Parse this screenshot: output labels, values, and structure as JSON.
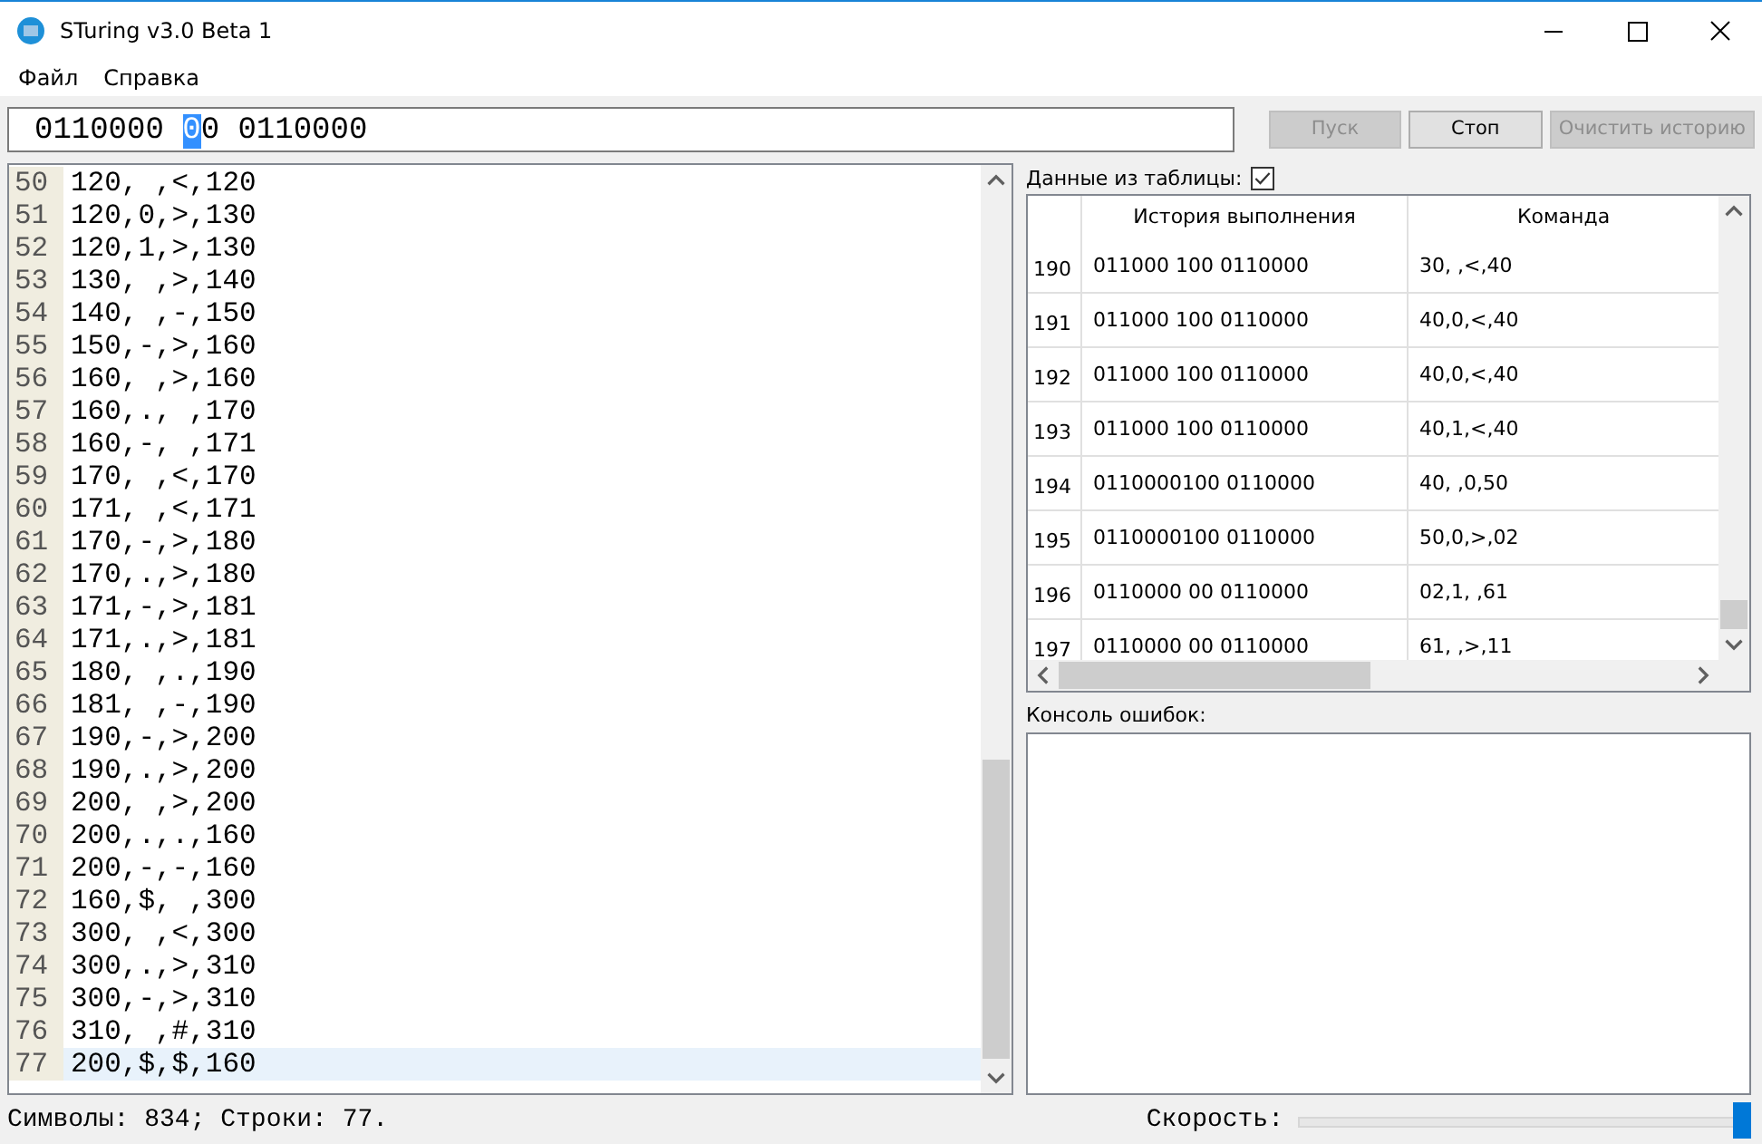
{
  "window": {
    "title": "STuring v3.0 Beta 1"
  },
  "menu": [
    "Файл",
    "Справка"
  ],
  "tape": {
    "before": "0110000 ",
    "head": "0",
    "after": "0 0110000"
  },
  "buttons": [
    {
      "label": "Пуск",
      "disabled": true
    },
    {
      "label": "Стоп",
      "disabled": false
    },
    {
      "label": "Очистить историю",
      "disabled": true
    }
  ],
  "editor": {
    "lines": [
      {
        "number": "50",
        "text": "120, ,<,120",
        "current": false
      },
      {
        "number": "51",
        "text": "120,0,>,130",
        "current": false
      },
      {
        "number": "52",
        "text": "120,1,>,130",
        "current": false
      },
      {
        "number": "53",
        "text": "130, ,>,140",
        "current": false
      },
      {
        "number": "54",
        "text": "140, ,-,150",
        "current": false
      },
      {
        "number": "55",
        "text": "150,-,>,160",
        "current": false
      },
      {
        "number": "56",
        "text": "160, ,>,160",
        "current": false
      },
      {
        "number": "57",
        "text": "160,., ,170",
        "current": false
      },
      {
        "number": "58",
        "text": "160,-, ,171",
        "current": false
      },
      {
        "number": "59",
        "text": "170, ,<,170",
        "current": false
      },
      {
        "number": "60",
        "text": "171, ,<,171",
        "current": false
      },
      {
        "number": "61",
        "text": "170,-,>,180",
        "current": false
      },
      {
        "number": "62",
        "text": "170,.,>,180",
        "current": false
      },
      {
        "number": "63",
        "text": "171,-,>,181",
        "current": false
      },
      {
        "number": "64",
        "text": "171,.,>,181",
        "current": false
      },
      {
        "number": "65",
        "text": "180, ,.,190",
        "current": false
      },
      {
        "number": "66",
        "text": "181, ,-,190",
        "current": false
      },
      {
        "number": "67",
        "text": "190,-,>,200",
        "current": false
      },
      {
        "number": "68",
        "text": "190,.,>,200",
        "current": false
      },
      {
        "number": "69",
        "text": "200, ,>,200",
        "current": false
      },
      {
        "number": "70",
        "text": "200,.,.,160",
        "current": false
      },
      {
        "number": "71",
        "text": "200,-,-,160",
        "current": false
      },
      {
        "number": "72",
        "text": "160,$, ,300",
        "current": false
      },
      {
        "number": "73",
        "text": "300, ,<,300",
        "current": false
      },
      {
        "number": "74",
        "text": "300,.,>,310",
        "current": false
      },
      {
        "number": "75",
        "text": "300,-,>,310",
        "current": false
      },
      {
        "number": "76",
        "text": "310, ,#,310",
        "current": false
      },
      {
        "number": "77",
        "text": "200,$,$,160",
        "current": true
      }
    ]
  },
  "table_option": {
    "label": "Данные из таблицы:",
    "checked": true
  },
  "history_table": {
    "columns": [
      "История выполнения",
      "Команда"
    ],
    "rows": [
      {
        "number": "190",
        "history": "011000 100 0110000",
        "command": "30, ,<,40"
      },
      {
        "number": "191",
        "history": "011000 100 0110000",
        "command": "40,0,<,40"
      },
      {
        "number": "192",
        "history": "011000 100 0110000",
        "command": "40,0,<,40"
      },
      {
        "number": "193",
        "history": "011000 100 0110000",
        "command": "40,1,<,40"
      },
      {
        "number": "194",
        "history": "0110000100 0110000",
        "command": "40, ,0,50"
      },
      {
        "number": "195",
        "history": "0110000100 0110000",
        "command": "50,0,>,02"
      },
      {
        "number": "196",
        "history": "0110000 00 0110000",
        "command": "02,1, ,61"
      },
      {
        "number": "197",
        "history": "0110000 00 0110000",
        "command": "61, ,>,11"
      }
    ]
  },
  "console": {
    "label": "Консоль ошибок:"
  },
  "status_bar": {
    "stats": "Символы: 834; Строки: 77.",
    "speed_label": "Скорость:",
    "speed": {
      "level": 1
    }
  }
}
